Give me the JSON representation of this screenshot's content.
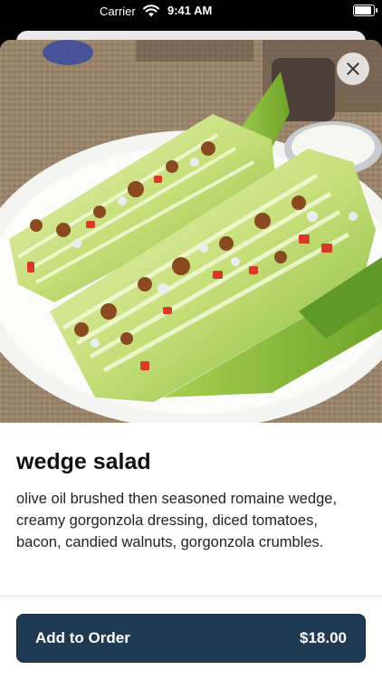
{
  "status_bar": {
    "carrier": "Carrier",
    "time": "9:41 AM",
    "battery_level": 0.95
  },
  "item": {
    "title": "wedge salad",
    "description": "olive oil brushed then seasoned romaine wedge, creamy gorgonzola dressing, diced tomatoes, bacon, candied walnuts, gorgonzola crumbles.",
    "photo_icon": "wedge-salad-photo"
  },
  "close_button": {
    "icon": "close-icon"
  },
  "order_button": {
    "label": "Add to Order",
    "price": "$18.00",
    "color": "#1f3b54"
  }
}
